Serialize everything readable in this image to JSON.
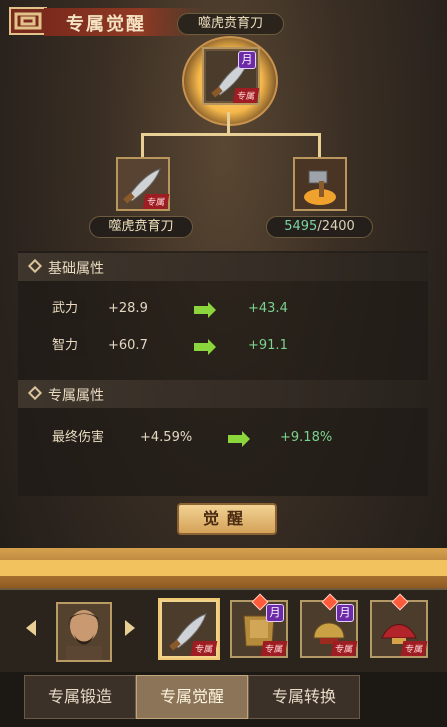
{
  "header": {
    "title": "专属觉醒"
  },
  "top_item": {
    "name": "噬虎贲育刀",
    "badge_moon": "月",
    "badge_tag": "专属"
  },
  "left_item": {
    "name": "噬虎贲育刀",
    "badge_tag": "专属"
  },
  "right_item": {
    "current": "5495",
    "required": "/2400"
  },
  "sections": {
    "base": {
      "title": "基础属性",
      "rows": [
        {
          "name": "武力",
          "old": "+28.9",
          "new": "+43.4"
        },
        {
          "name": "智力",
          "old": "+60.7",
          "new": "+91.1"
        }
      ]
    },
    "exclusive": {
      "title": "专属属性",
      "rows": [
        {
          "name": "最终伤害",
          "old": "+4.59%",
          "new": "+9.18%"
        }
      ]
    }
  },
  "buttons": {
    "awaken": "觉醒"
  },
  "tray": {
    "tags": [
      "专属",
      "专属",
      "专属",
      "专属"
    ],
    "moons": [
      "月",
      "月"
    ]
  },
  "tabs": [
    {
      "label": "专属锻造",
      "active": false
    },
    {
      "label": "专属觉醒",
      "active": true
    },
    {
      "label": "专属转换",
      "active": false
    }
  ],
  "colors": {
    "accent_gold": "#f2d292",
    "green": "#7ad28d",
    "panel": "#2b241d"
  }
}
